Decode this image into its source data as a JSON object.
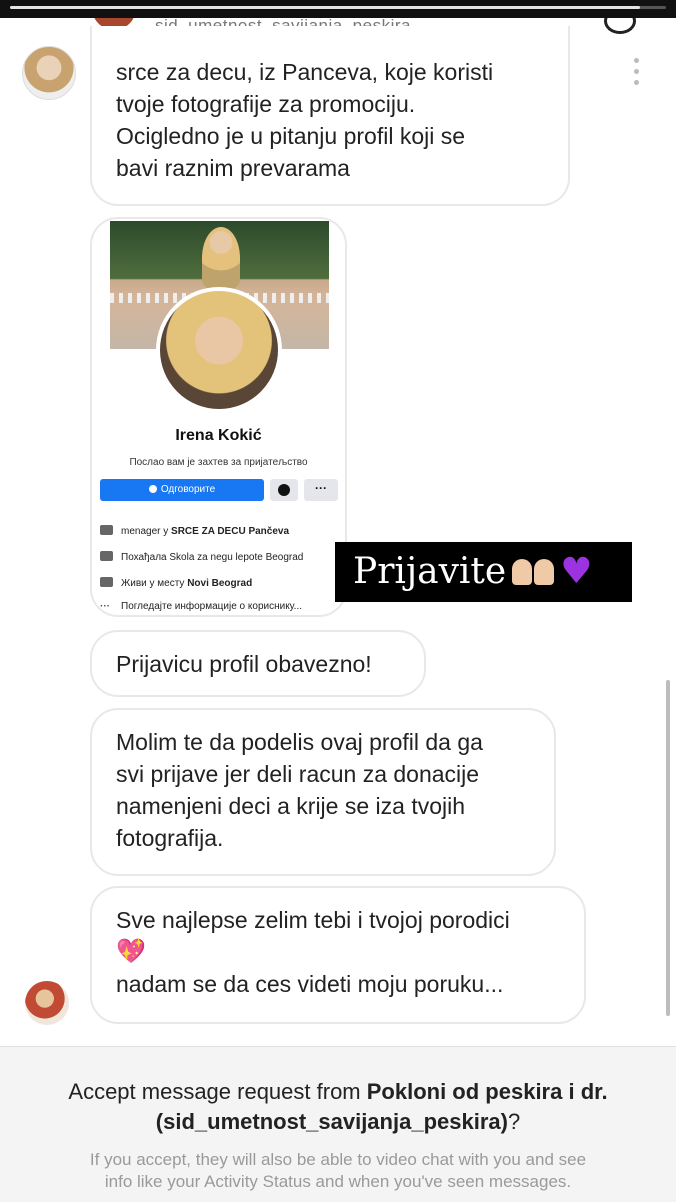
{
  "story": {
    "header_username": "sid_umetnost_savijanja_peskira",
    "sender_overlay": "s"
  },
  "messages": {
    "first_lines": [
      "srce za decu, iz Panceva, koje koristi",
      "tvoje fotografije za promociju.",
      "Ocigledno je u pitanju profil koji se",
      "bavi raznim prevarama"
    ],
    "second": "Prijavicu profil obavezno!",
    "third_lines": [
      "Molim te da podelis ovaj profil da ga",
      "svi prijave jer deli racun za donacije",
      "namenjeni deci a krije se iza tvojih",
      "fotografija."
    ],
    "fourth_lines": [
      "Sve najlepse zelim tebi i tvojoj porodici",
      "💖",
      "nadam se da ces videti moju poruku..."
    ]
  },
  "shared_profile": {
    "name": "Irena Kokić",
    "subtitle": "Послао вам је захтев за пријатељство",
    "respond_button": "Одговорите",
    "more_button": "···",
    "work": {
      "prefix": "menager у ",
      "bold": "SRCE ZA DECU Pančeva"
    },
    "education": "Похађала Skola za negu lepote Beograd",
    "lives": {
      "prefix": "Живи у месту ",
      "bold": "Novi Beograd"
    },
    "see_info": "Погледајте информације о кориснику..."
  },
  "sticker": {
    "text": "Prijavite",
    "emoji_color": "#9b33e0"
  },
  "request": {
    "title_prefix": "Accept message request from ",
    "title_bold_1": "Pokloni od peskira i dr.",
    "title_bold_2": "(sid_umetnost_savijanja_peskira)",
    "title_suffix": "?",
    "subtitle_line_1": "If you accept, they will also be able to video chat with you and see",
    "subtitle_line_2": "info like your Activity Status and when you've seen messages."
  },
  "icons": [
    "more-vertical-icon",
    "messenger-icon",
    "work-icon",
    "education-icon",
    "home-icon",
    "more-dots-icon",
    "person-icon"
  ],
  "colors": {
    "fb_blue": "#1877f2",
    "bubble_border": "#e8e8e8",
    "request_bg": "#f4f4f4",
    "muted_text": "#9a9a9a"
  },
  "story_progress": 0.96
}
